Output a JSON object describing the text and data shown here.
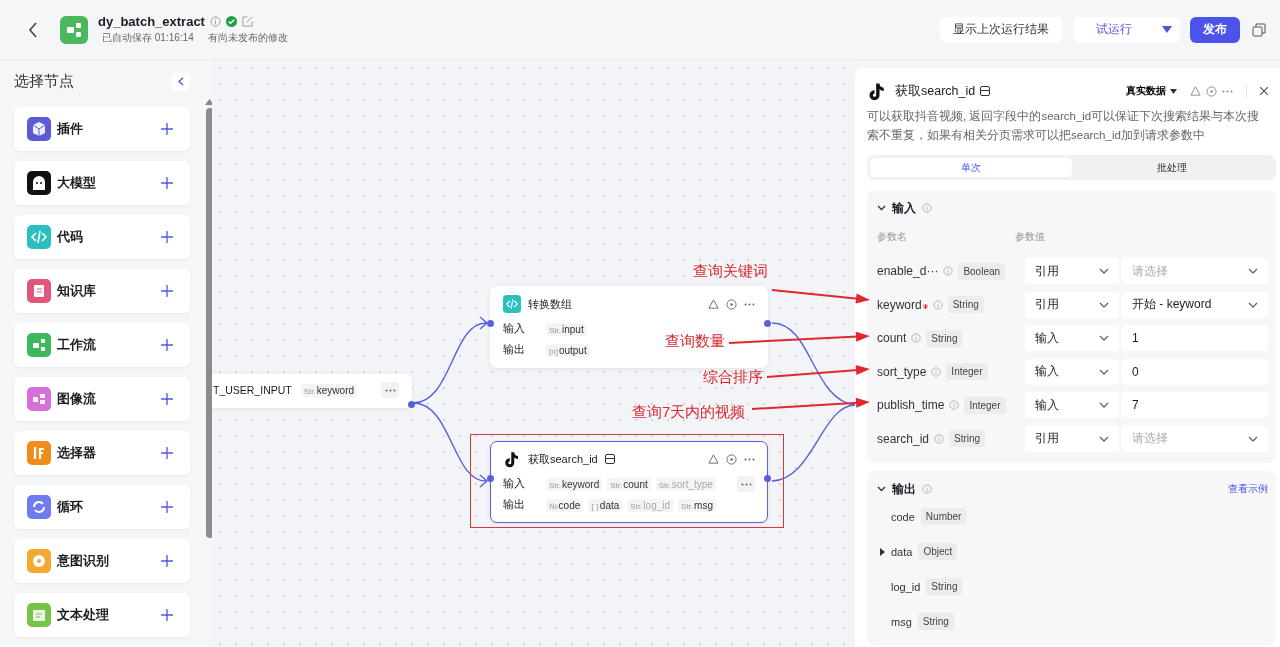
{
  "header": {
    "title": "dy_batch_extract",
    "saved": "已自动保存 01:16:14",
    "unpublished": "有尚未发布的修改",
    "buttons": {
      "last_run": "显示上次运行结果",
      "test_run": "试运行",
      "publish": "发布"
    }
  },
  "sidebar": {
    "title": "选择节点",
    "items": [
      {
        "label": "插件",
        "kind": "plugin",
        "color": "#5b5bd6"
      },
      {
        "label": "大模型",
        "kind": "llm",
        "color": "#111111"
      },
      {
        "label": "代码",
        "kind": "code",
        "color": "#2bbfbf"
      },
      {
        "label": "知识库",
        "kind": "knowledge",
        "color": "#e0577a"
      },
      {
        "label": "工作流",
        "kind": "workflow",
        "color": "#3cb95c"
      },
      {
        "label": "图像流",
        "kind": "imageflow",
        "color": "#d86fd9"
      },
      {
        "label": "选择器",
        "kind": "selector",
        "color": "#f08c1a"
      },
      {
        "label": "循环",
        "kind": "loop",
        "color": "#6f7cf0"
      },
      {
        "label": "意图识别",
        "kind": "intent",
        "color": "#f4a92e"
      },
      {
        "label": "文本处理",
        "kind": "text",
        "color": "#78c34a"
      }
    ]
  },
  "canvas": {
    "nodes": [
      {
        "kind": "partial",
        "selected": false,
        "highlighted": false,
        "rows": [
          {
            "label": "T_USER_INPUT",
            "tags": [
              {
                "prefix": "Str.",
                "name": "keyword"
              }
            ],
            "more": true
          }
        ]
      },
      {
        "kind": "code",
        "title": "转换数组",
        "selected": false,
        "highlighted": false,
        "rows": [
          {
            "label": "输入",
            "tags": [
              {
                "prefix": "Str.",
                "name": "input"
              }
            ],
            "more": false
          },
          {
            "label": "输出",
            "tags": [
              {
                "prefix": "[n]",
                "name": "output"
              }
            ],
            "more": false
          }
        ]
      },
      {
        "kind": "tiktok",
        "title": "获取search_id",
        "selected": true,
        "highlighted": true,
        "rows": [
          {
            "label": "输入",
            "tags": [
              {
                "prefix": "Str.",
                "name": "keyword"
              },
              {
                "prefix": "Str.",
                "name": "count"
              },
              {
                "prefix": "Str.",
                "name": "sort_type"
              }
            ],
            "more": true
          },
          {
            "label": "输出",
            "tags": [
              {
                "prefix": "№",
                "name": "code"
              },
              {
                "prefix": "{ }",
                "name": "data"
              },
              {
                "prefix": "Str.",
                "name": "log_id"
              },
              {
                "prefix": "Str.",
                "name": "msg"
              }
            ],
            "more": false
          }
        ]
      }
    ],
    "annotations": [
      {
        "text": "查询关键词"
      },
      {
        "text": "查询数量"
      },
      {
        "text": "综合排序"
      },
      {
        "text": "查询7天内的视频"
      }
    ]
  },
  "panel": {
    "title": "获取search_id",
    "data_mode": "真实数据",
    "description": "可以获取抖音视频, 返回字段中的search_id可以保证下次搜索结果与本次搜索不重复，如果有相关分页需求可以把search_id加到请求参数中",
    "tabs": [
      {
        "label": "单次",
        "selected": true
      },
      {
        "label": "批处理",
        "selected": false
      }
    ],
    "input": {
      "title": "输入",
      "col_name": "参数名",
      "col_value": "参数值",
      "rows": [
        {
          "name": "enable_d···",
          "required": false,
          "type": "Boolean",
          "mode": "引用",
          "kind": "select",
          "placeholder": "请选择"
        },
        {
          "name": "keyword",
          "required": true,
          "type": "String",
          "mode": "引用",
          "kind": "select",
          "value": "开始 - keyword"
        },
        {
          "name": "count",
          "required": false,
          "type": "String",
          "mode": "输入",
          "kind": "input",
          "value": "1"
        },
        {
          "name": "sort_type",
          "required": false,
          "type": "Integer",
          "mode": "输入",
          "kind": "input",
          "value": "0"
        },
        {
          "name": "publish_time",
          "required": false,
          "type": "Integer",
          "mode": "输入",
          "kind": "input",
          "value": "7"
        },
        {
          "name": "search_id",
          "required": false,
          "type": "String",
          "mode": "引用",
          "kind": "select",
          "placeholder": "请选择"
        }
      ]
    },
    "output": {
      "title": "输出",
      "link": "查看示例",
      "rows": [
        {
          "name": "code",
          "type": "Number",
          "kind": "leaf"
        },
        {
          "name": "data",
          "type": "Object",
          "kind": "object",
          "expanded": false
        },
        {
          "name": "log_id",
          "type": "String",
          "kind": "leaf"
        },
        {
          "name": "msg",
          "type": "String",
          "kind": "leaf"
        }
      ]
    }
  }
}
